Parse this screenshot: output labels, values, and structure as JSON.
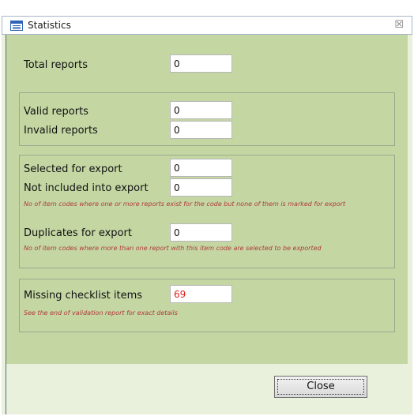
{
  "window": {
    "title": "Statistics",
    "close_glyph": "☒"
  },
  "total": {
    "label": "Total reports",
    "value": "0"
  },
  "validity": {
    "valid_label": "Valid reports",
    "valid_value": "0",
    "invalid_label": "Invalid reports",
    "invalid_value": "0"
  },
  "export": {
    "selected_label": "Selected for export",
    "selected_value": "0",
    "not_included_label": "Not included into export",
    "not_included_value": "0",
    "not_included_note": "No of item codes where one or more reports exist for the code but none of them is marked for export",
    "duplicates_label": "Duplicates for export",
    "duplicates_value": "0",
    "duplicates_note": "No of item codes where more than one report with this item code are selected to be exported"
  },
  "missing": {
    "label": "Missing checklist items",
    "value": "69",
    "note": "See the end of validation report for exact details"
  },
  "footer": {
    "close_label": "Close"
  },
  "colors": {
    "panel": "#c4d7a3",
    "footer": "#e9f0dc",
    "highlight_value": "#e02020"
  }
}
